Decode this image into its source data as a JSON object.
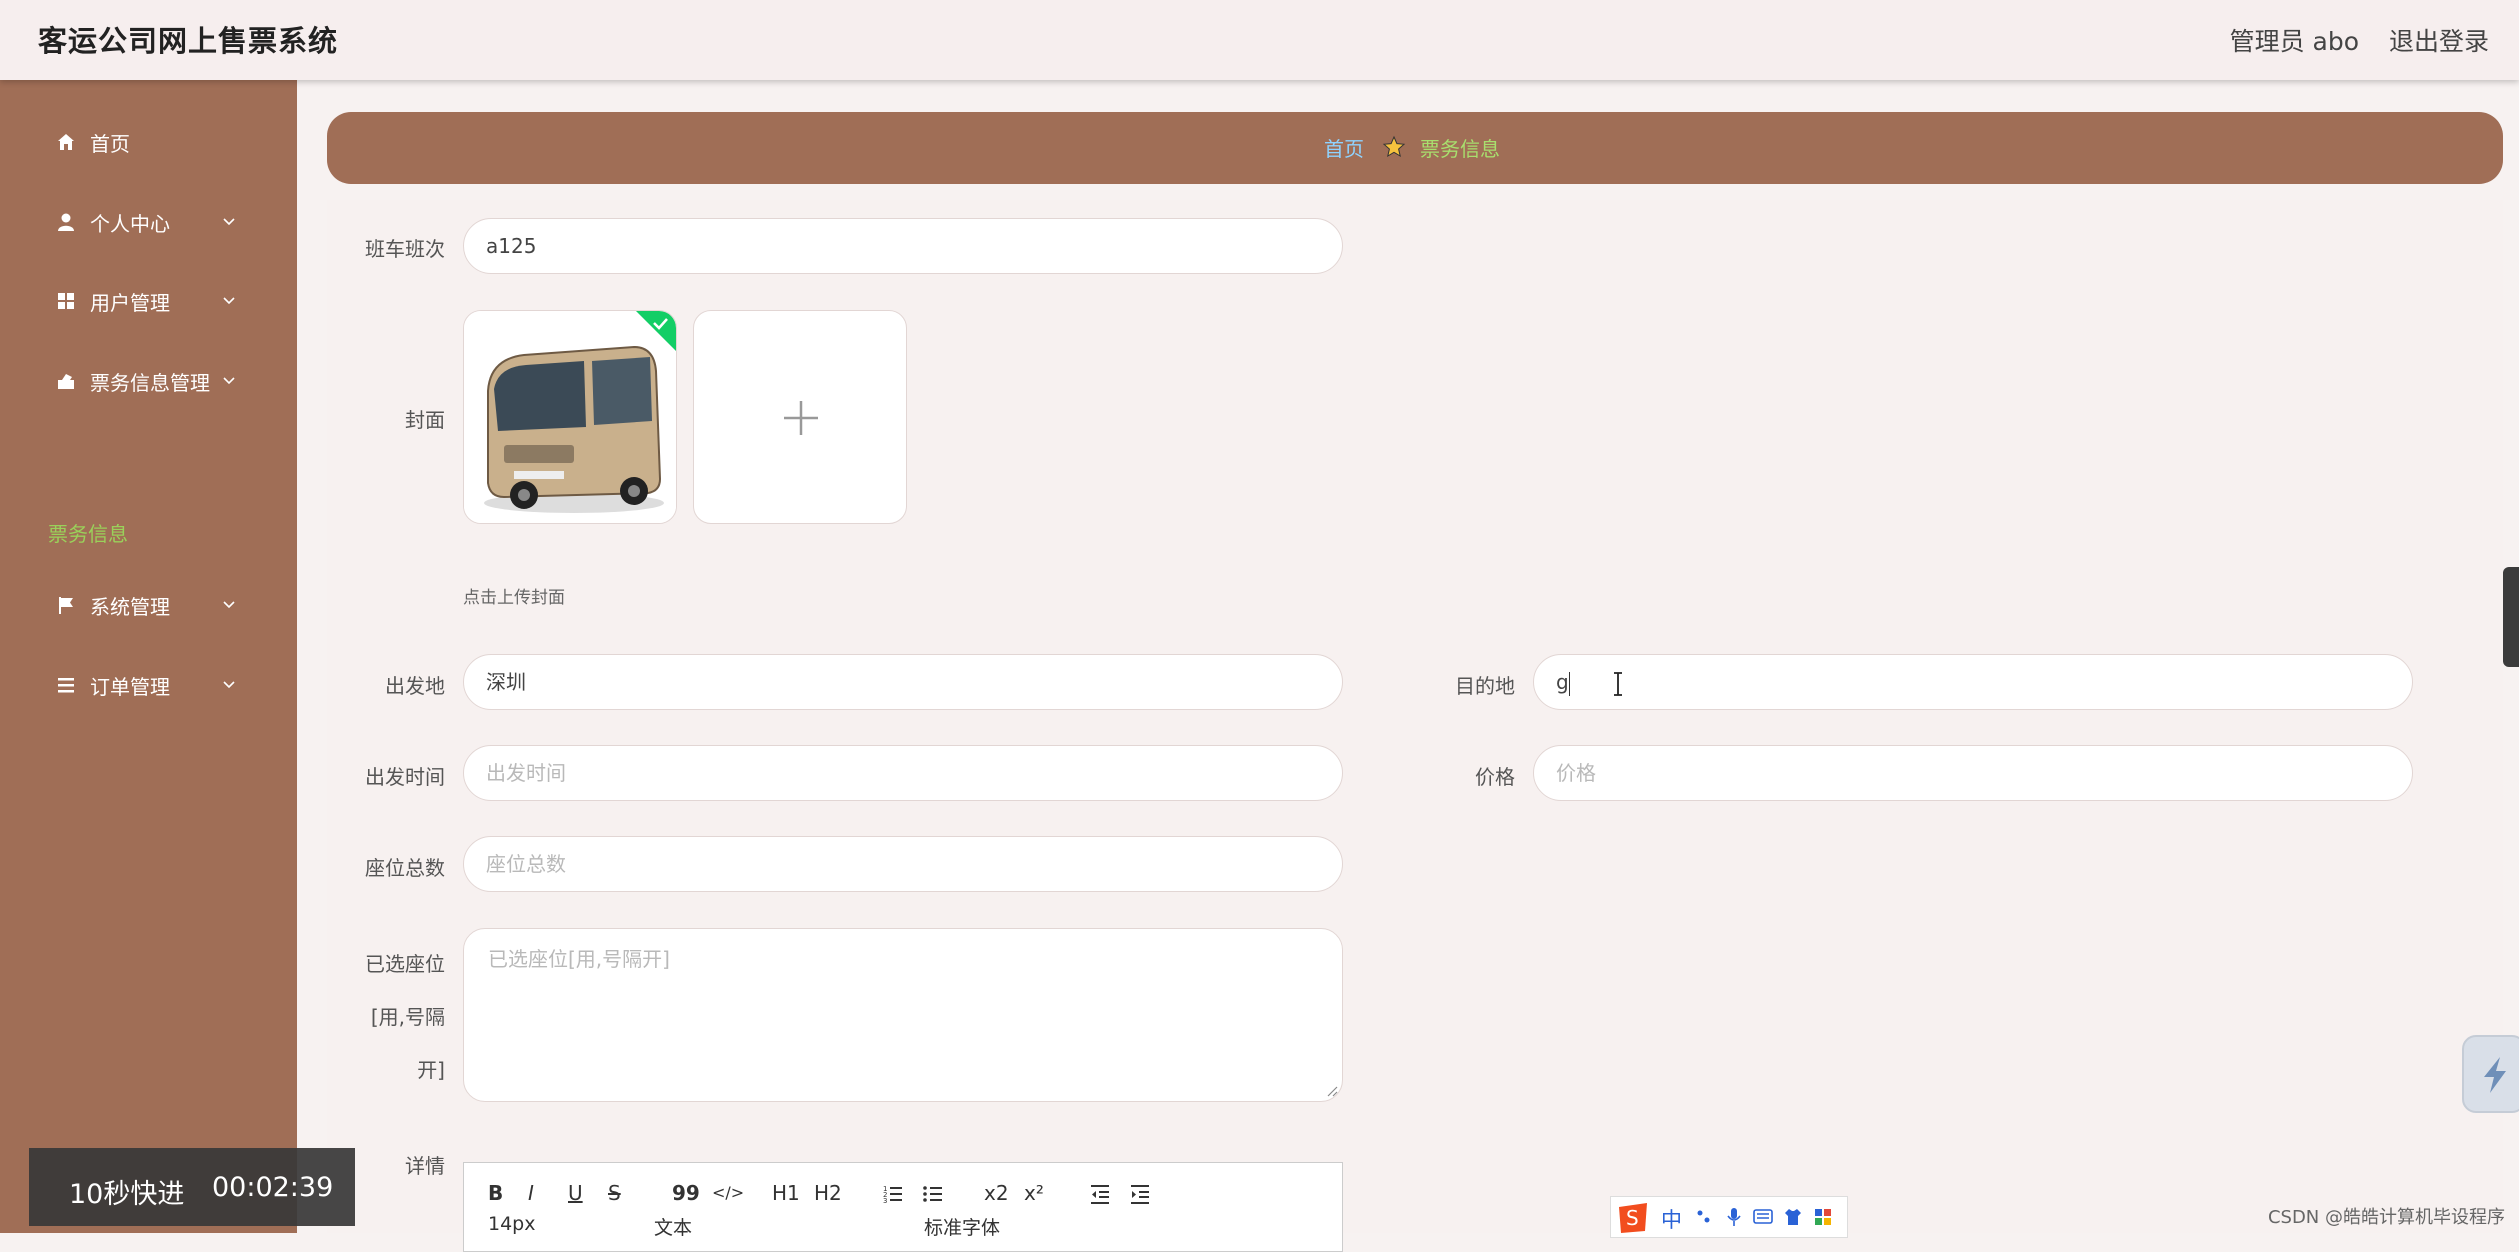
{
  "header": {
    "title": "客运公司网上售票系统",
    "user": "管理员 abo",
    "logout": "退出登录"
  },
  "sidebar": {
    "items": [
      {
        "label": "首页",
        "icon": "home-icon"
      },
      {
        "label": "个人中心",
        "icon": "user-icon"
      },
      {
        "label": "用户管理",
        "icon": "grid-icon"
      },
      {
        "label": "票务信息管理",
        "icon": "ticket-icon"
      },
      {
        "label": "系统管理",
        "icon": "flag-icon"
      },
      {
        "label": "订单管理",
        "icon": "list-icon"
      }
    ],
    "active_sub": "票务信息"
  },
  "breadcrumb": {
    "home": "首页",
    "current": "票务信息"
  },
  "form": {
    "bus_number": {
      "label": "班车班次",
      "value": "a125"
    },
    "cover": {
      "label": "封面",
      "hint": "点击上传封面"
    },
    "departure": {
      "label": "出发地",
      "value": "深圳"
    },
    "destination": {
      "label": "目的地",
      "value": "g"
    },
    "depart_time": {
      "label": "出发时间",
      "placeholder": "出发时间"
    },
    "price": {
      "label": "价格",
      "placeholder": "价格"
    },
    "seat_total": {
      "label": "座位总数",
      "placeholder": "座位总数"
    },
    "selected_seats": {
      "label_lines": [
        "已选座位",
        "[用,号隔",
        "开]"
      ],
      "placeholder": "已选座位[用,号隔开]"
    },
    "details": {
      "label": "详情"
    }
  },
  "editor": {
    "row1": [
      "B",
      "I",
      "U",
      "S",
      "99",
      "</>",
      "H1",
      "H2",
      "ol",
      "ul",
      "x2",
      "x²",
      "outdent",
      "indent"
    ],
    "font_size": "14px",
    "text_style": "文本",
    "font_family": "标准字体"
  },
  "video": {
    "label": "10秒快进",
    "time": "00:02:39"
  },
  "watermark": "CSDN @皓皓计算机毕设程序",
  "ime": {
    "mode": "中"
  },
  "colors": {
    "sidebar": "#a06e56",
    "banner": "#a06e56",
    "crumb_home": "#8fd3ff",
    "crumb_current": "#a8df6e",
    "active_sub": "#9ad15a"
  }
}
